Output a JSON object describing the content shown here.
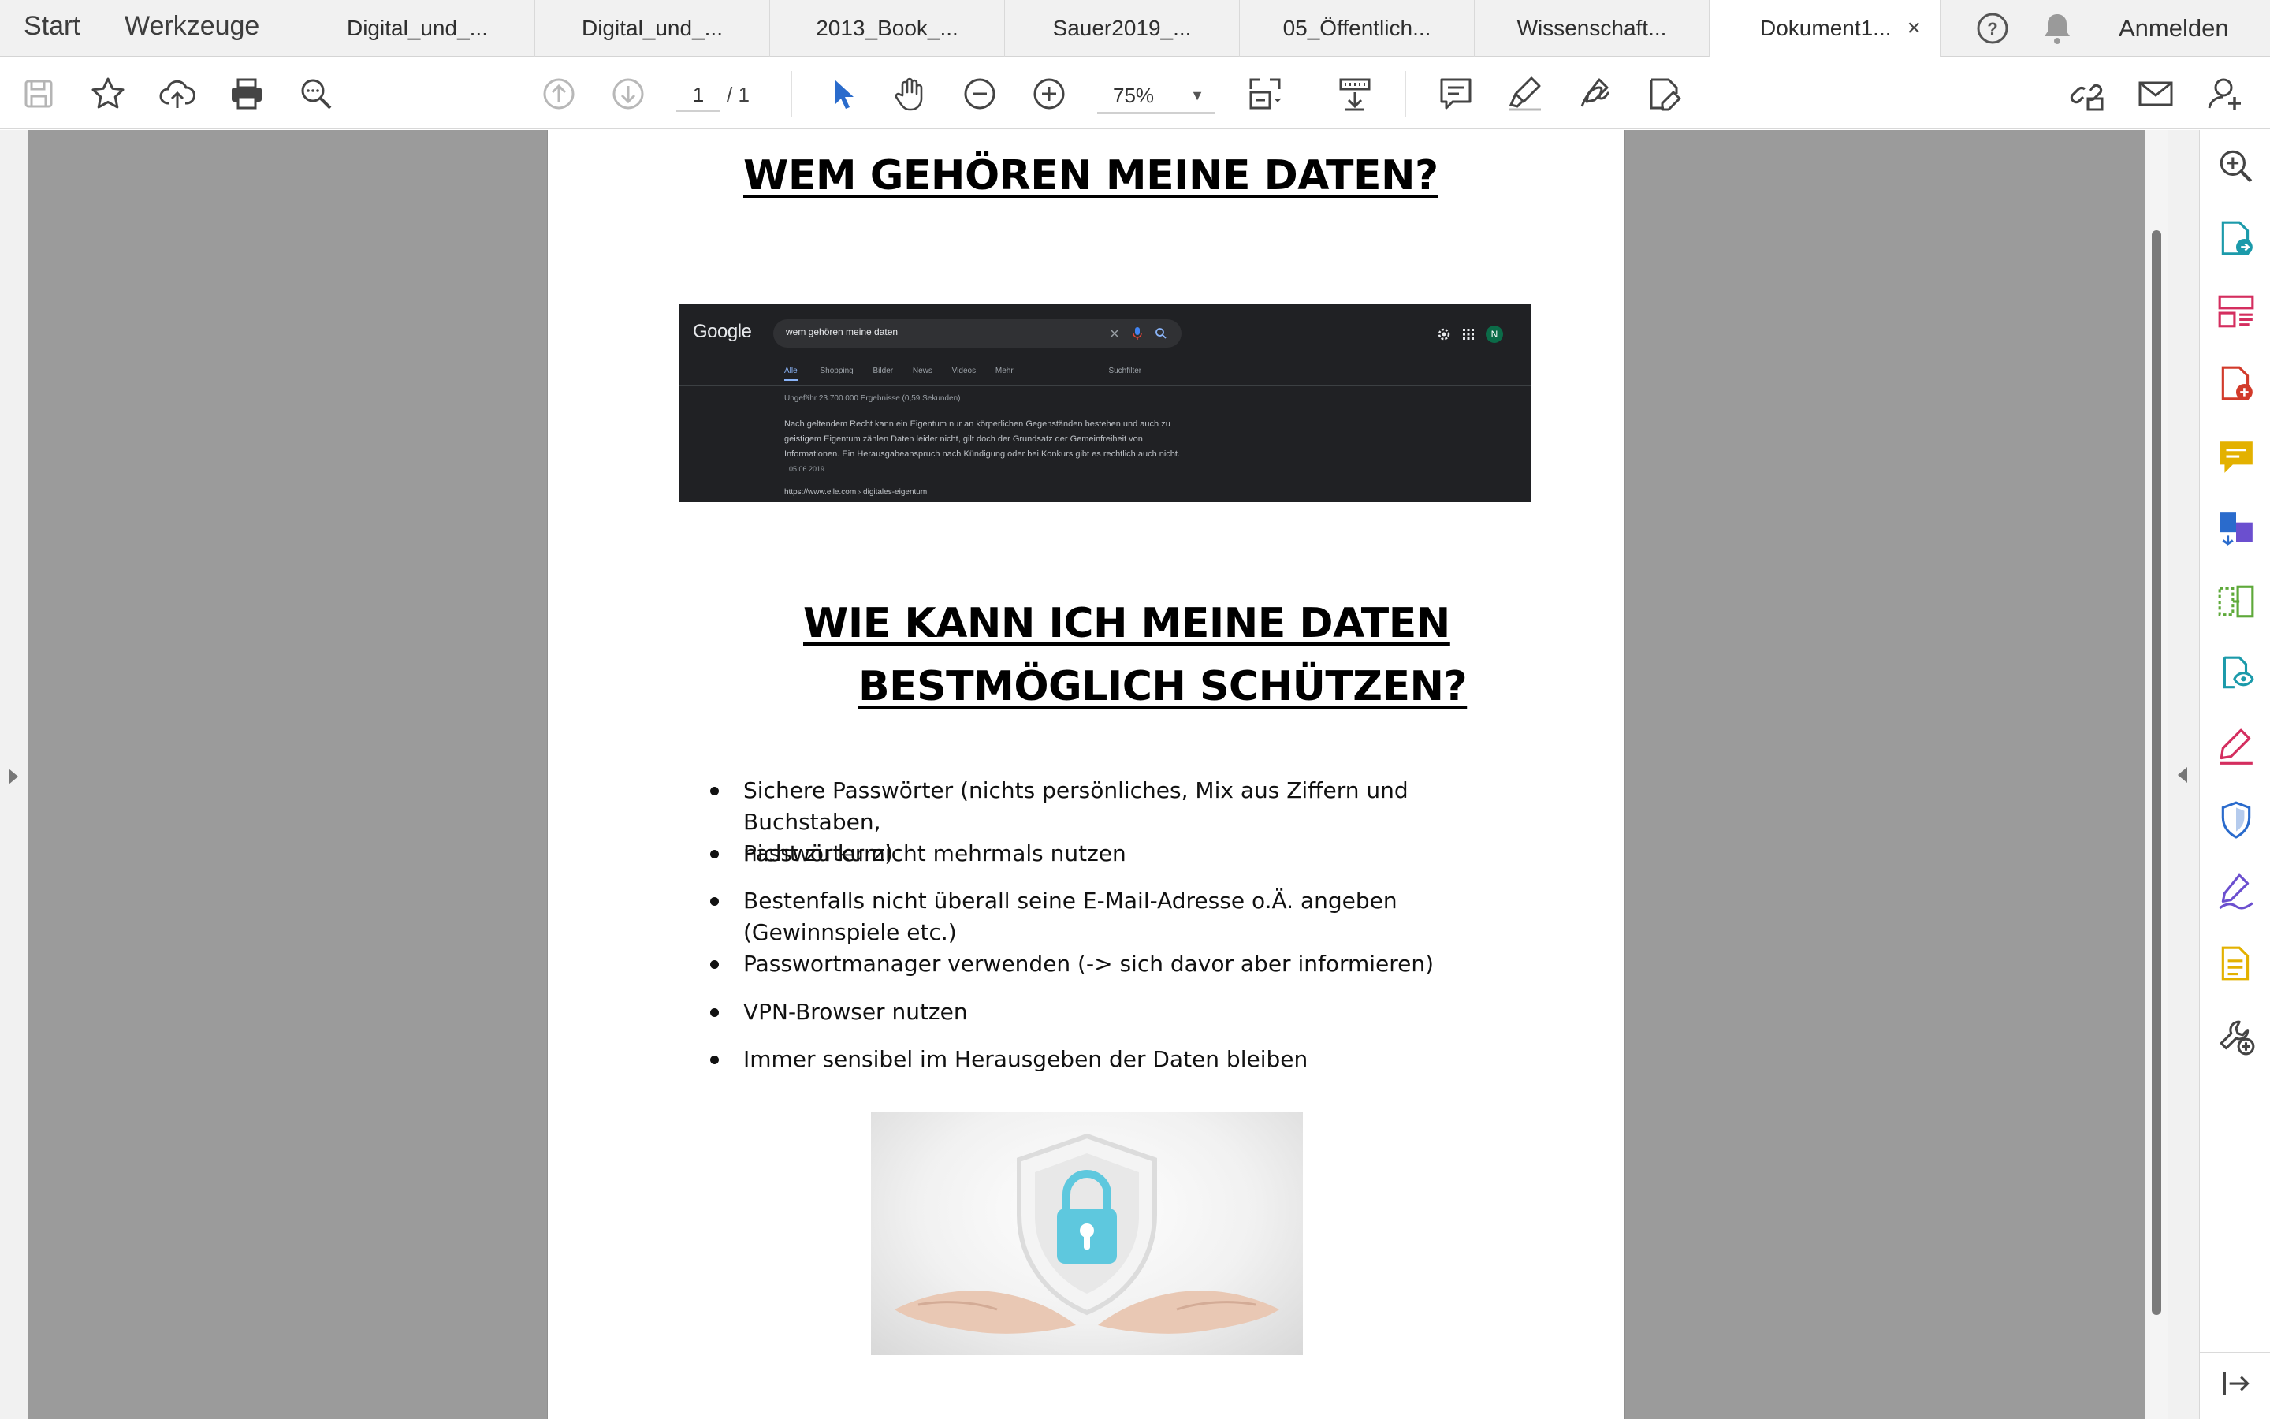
{
  "tabs": {
    "start": "Start",
    "tools": "Werkzeuge",
    "documents": [
      {
        "label": "Digital_und_..."
      },
      {
        "label": "Digital_und_..."
      },
      {
        "label": "2013_Book_..."
      },
      {
        "label": "Sauer2019_..."
      },
      {
        "label": "05_Öffentlich..."
      },
      {
        "label": "Wissenschaft..."
      },
      {
        "label": "Dokument1..."
      }
    ],
    "close_symbol": "×",
    "sign_in": "Anmelden"
  },
  "toolbar": {
    "page_current": "1",
    "page_total": "/ 1",
    "zoom": "75%",
    "icons": [
      "save-icon",
      "star-icon",
      "cloud-upload-icon",
      "print-icon",
      "search-icon",
      "page-up-icon",
      "page-down-icon",
      "select-cursor-icon",
      "hand-icon",
      "zoom-out-icon",
      "zoom-in-icon",
      "fit-page-icon",
      "scroll-mode-icon",
      "comment-icon",
      "highlight-icon",
      "sign-icon",
      "edit-icon",
      "share-link-icon",
      "mail-icon",
      "add-person-icon"
    ]
  },
  "document": {
    "heading1": "WEM GEHÖREN MEINE DATEN?",
    "heading2_line1": "WIE KANN ICH MEINE DATEN",
    "heading2_line2": "BESTMÖGLICH SCHÜTZEN?",
    "google_screenshot": {
      "logo": "Google",
      "query": "wem gehören meine daten",
      "tabs": [
        "Alle",
        "Shopping",
        "Bilder",
        "News",
        "Videos",
        "Mehr"
      ],
      "filter": "Suchfilter",
      "stats": "Ungefähr 23.700.000 Ergebnisse (0,59 Sekunden)",
      "snippet": "Nach geltendem Recht kann ein Eigentum nur an körperlichen Gegenständen bestehen und auch zu geistigem Eigentum zählen Daten leider nicht, gilt doch der Grundsatz der Gemeinfreiheit von Informationen. Ein Herausgabeanspruch nach Kündigung oder bei Konkurs gibt es rechtlich auch nicht.",
      "date": "05.06.2019",
      "url": "https://www.elle.com › digitales-eigentum",
      "avatar": "N"
    },
    "bullets": [
      {
        "line1": "Sichere Passwörter (nichts persönliches, Mix aus Ziffern und Buchstaben,",
        "line2": "nicht zu kurz)"
      },
      {
        "line1": "Passwörter nicht mehrmals nutzen",
        "line2": ""
      },
      {
        "line1": "Bestenfalls nicht überall seine E-Mail-Adresse o.Ä. angeben",
        "line2": "(Gewinnspiele etc.)"
      },
      {
        "line1": "Passwortmanager verwenden (-> sich davor aber informieren)",
        "line2": ""
      },
      {
        "line1": "VPN-Browser nutzen",
        "line2": ""
      },
      {
        "line1": "Immer sensibel im Herausgeben der Daten bleiben",
        "line2": ""
      }
    ]
  },
  "right_panel": {
    "tools": [
      "zoom-icon",
      "create-pdf-icon",
      "organize-pages-icon",
      "export-pdf-icon",
      "comment-icon",
      "combine-files-icon",
      "compare-files-icon",
      "scan-icon",
      "fill-sign-icon",
      "protect-icon",
      "request-signature-icon",
      "more-tools-icon",
      "customize-tools-icon"
    ],
    "colors": {
      "blue": "#2a6bcc",
      "teal": "#1b9aaa",
      "pink": "#d42e5f",
      "red": "#d23a2a",
      "yellow": "#e3b100",
      "purple": "#6b4fcf",
      "green": "#5ea93a"
    }
  }
}
